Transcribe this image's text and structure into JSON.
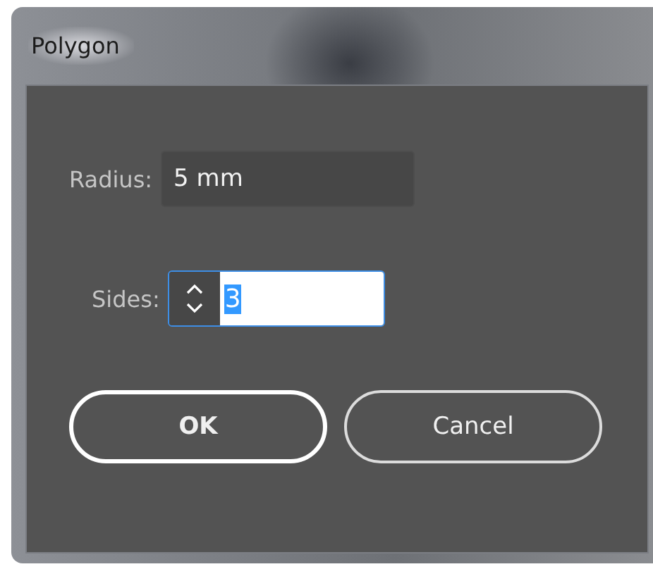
{
  "window": {
    "title": "Polygon"
  },
  "fields": [
    {
      "kind": "text",
      "label": "Radius:",
      "value": "5 mm"
    },
    {
      "kind": "spinner",
      "label": "Sides:",
      "value": "3",
      "value_selected": true,
      "focused": true
    }
  ],
  "buttons": [
    {
      "label": "OK",
      "default": true
    },
    {
      "label": "Cancel",
      "default": false
    }
  ]
}
